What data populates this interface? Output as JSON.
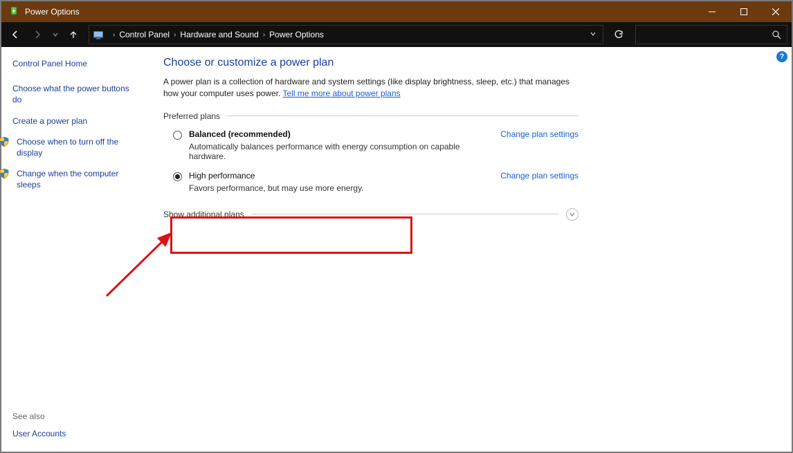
{
  "titlebar": {
    "title": "Power Options"
  },
  "breadcrumb": {
    "items": [
      "Control Panel",
      "Hardware and Sound",
      "Power Options"
    ]
  },
  "sidebar": {
    "home": "Control Panel Home",
    "links": [
      "Choose what the power buttons do",
      "Create a power plan",
      "Choose when to turn off the display",
      "Change when the computer sleeps"
    ],
    "see_also_label": "See also",
    "see_also_links": [
      "User Accounts"
    ]
  },
  "content": {
    "heading": "Choose or customize a power plan",
    "intro_prefix": "A power plan is a collection of hardware and system settings (like display brightness, sleep, etc.) that manages how your computer uses power. ",
    "intro_link": "Tell me more about power plans",
    "preferred_label": "Preferred plans",
    "plans": [
      {
        "name": "Balanced (recommended)",
        "desc": "Automatically balances performance with energy consumption on capable hardware.",
        "selected": false,
        "bold": true
      },
      {
        "name": "High performance",
        "desc": "Favors performance, but may use more energy.",
        "selected": true,
        "bold": false
      }
    ],
    "change_link": "Change plan settings",
    "show_more": "Show additional plans"
  }
}
